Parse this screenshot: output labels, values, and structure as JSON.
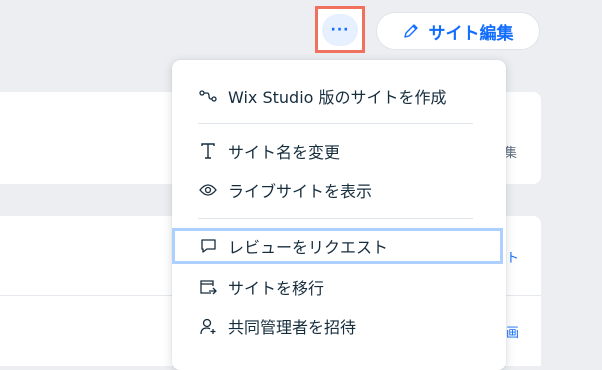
{
  "background": {
    "peek_texts": [
      "集",
      "ト",
      "画"
    ]
  },
  "toolbar": {
    "more_label": "···",
    "edit_site_label": "サイト編集"
  },
  "menu": {
    "items": [
      {
        "label": "Wix Studio 版のサイトを作成",
        "icon": "flow-nodes-icon"
      },
      {
        "label": "サイト名を変更",
        "icon": "text-t-icon"
      },
      {
        "label": "ライブサイトを表示",
        "icon": "eye-icon"
      },
      {
        "label": "レビューをリクエスト",
        "icon": "comment-icon"
      },
      {
        "label": "サイトを移行",
        "icon": "transfer-icon"
      },
      {
        "label": "共同管理者を招待",
        "icon": "add-person-icon"
      }
    ]
  },
  "colors": {
    "accent": "#116dff",
    "highlight_outline": "#f0715e",
    "focus_outline": "#aed0ff",
    "text": "#162d3d"
  }
}
